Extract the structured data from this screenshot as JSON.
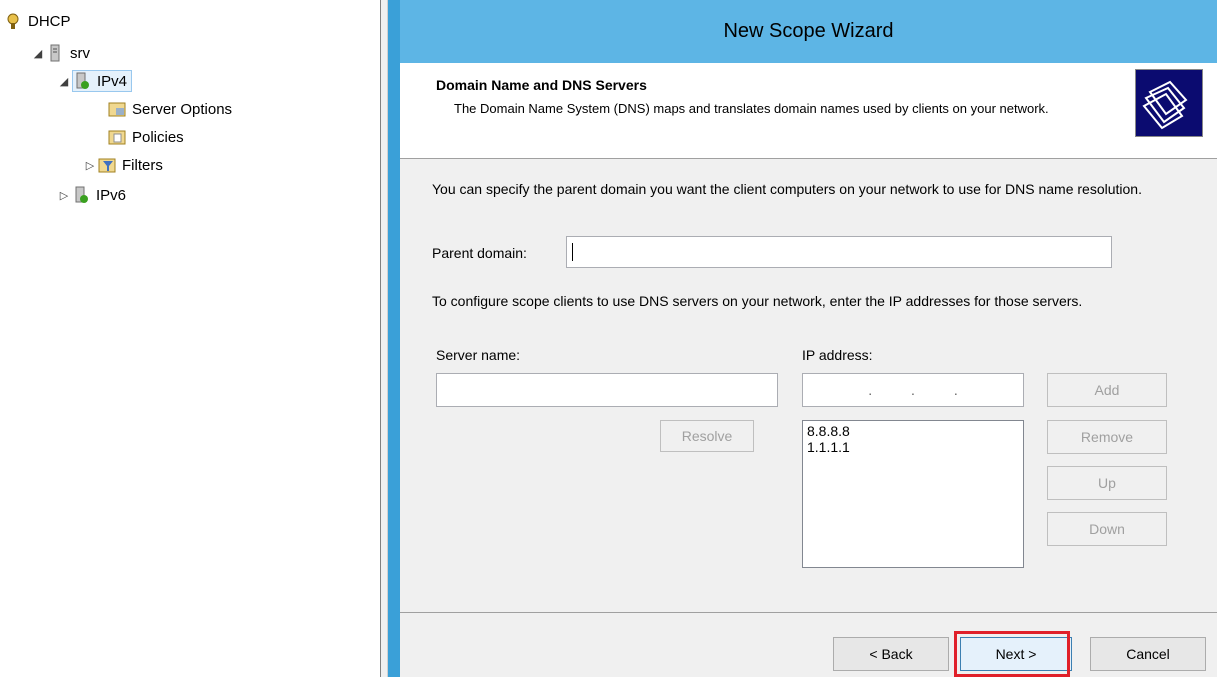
{
  "tree": {
    "root": "DHCP",
    "server": "srv",
    "ipv4": "IPv4",
    "server_options": "Server Options",
    "policies": "Policies",
    "filters": "Filters",
    "ipv6": "IPv6"
  },
  "wizard": {
    "title": "New Scope Wizard",
    "header_title": "Domain Name and DNS Servers",
    "header_subtitle": "The Domain Name System (DNS) maps and translates domain names used by clients on your network.",
    "intro": "You can specify the parent domain you want the client computers on your network to use for DNS name resolution.",
    "parent_domain_label": "Parent domain:",
    "parent_domain_value": "",
    "dns_intro": "To configure scope clients to use DNS servers on your network, enter the IP addresses for those servers.",
    "server_name_label": "Server name:",
    "server_name_value": "",
    "ip_address_label": "IP address:",
    "ip_placeholder": ".          .          .",
    "resolve_label": "Resolve",
    "add_label": "Add",
    "remove_label": "Remove",
    "up_label": "Up",
    "down_label": "Down",
    "dns_servers": [
      "8.8.8.8",
      "1.1.1.1"
    ],
    "back_label": "< Back",
    "next_label": "Next >",
    "cancel_label": "Cancel"
  },
  "colors": {
    "title_bar": "#5db5e5",
    "frame": "#3aa0d8",
    "highlight": "#e0202a"
  }
}
